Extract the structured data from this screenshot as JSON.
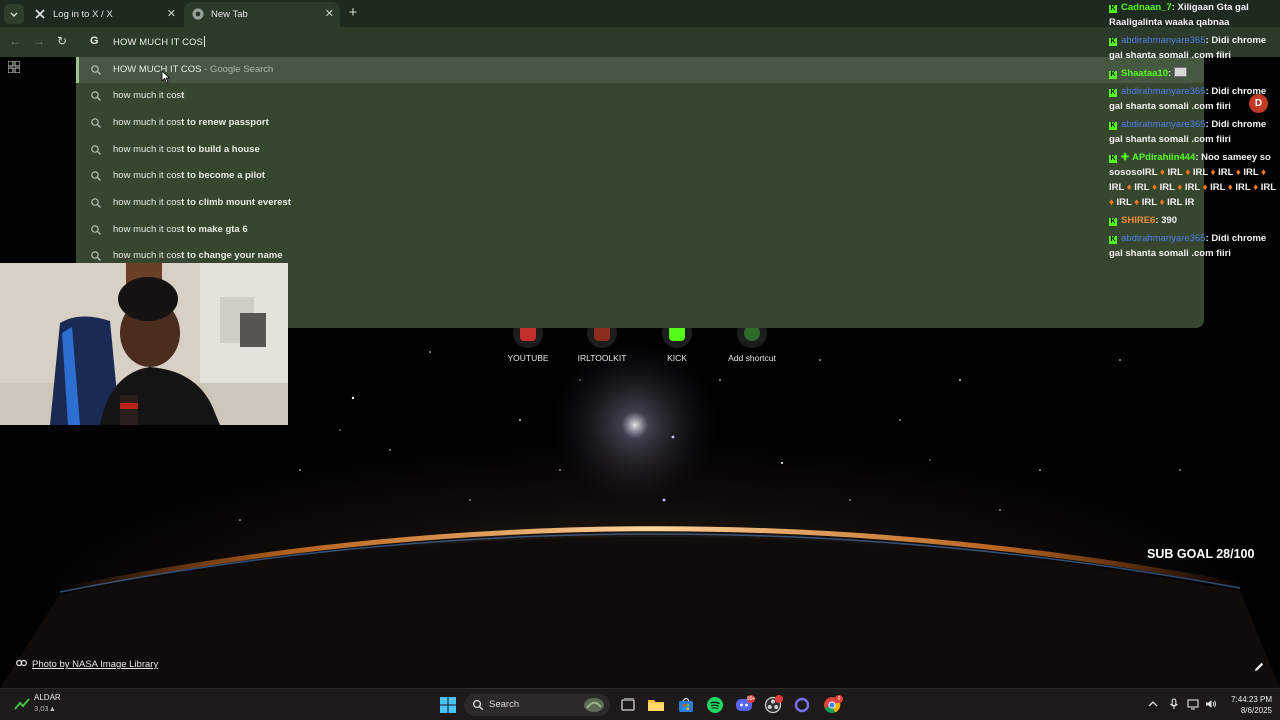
{
  "tabs": [
    {
      "title": "Log in to X / X",
      "icon": "x-logo-icon",
      "active": false
    },
    {
      "title": "New Tab",
      "icon": "chrome-icon",
      "active": true
    }
  ],
  "omnibox": {
    "g_label": "G",
    "query": "HOW MUCH IT COS"
  },
  "suggestions": [
    {
      "prefix": "HOW MUCH IT COS",
      "suffix": "",
      "suffix_plain": " - Google Search",
      "selected": true
    },
    {
      "prefix": "how much it cos",
      "suffix": "t",
      "suffix_plain": "",
      "selected": false
    },
    {
      "prefix": "how much it cos",
      "suffix": "t to renew passport",
      "suffix_plain": "",
      "selected": false
    },
    {
      "prefix": "how much it cos",
      "suffix": "t to build a house",
      "suffix_plain": "",
      "selected": false
    },
    {
      "prefix": "how much it cos",
      "suffix": "t to become a pilot",
      "suffix_plain": "",
      "selected": false
    },
    {
      "prefix": "how much it cos",
      "suffix": "t to climb mount everest",
      "suffix_plain": "",
      "selected": false
    },
    {
      "prefix": "how much it cos",
      "suffix": "t to make gta 6",
      "suffix_plain": "",
      "selected": false
    },
    {
      "prefix": "how much it cos",
      "suffix": "t to change your name",
      "suffix_plain": "",
      "selected": false
    }
  ],
  "shortcuts": [
    {
      "label": "YOUTUBE",
      "color": "#c4302b"
    },
    {
      "label": "IRLTOOLKIT",
      "color": "#8b2f1c"
    },
    {
      "label": "KICK",
      "color": "#53fc18"
    },
    {
      "label": "Add shortcut",
      "color": "#2f6b2a"
    }
  ],
  "chat": [
    {
      "user": "Cadnaan_7",
      "user_color": "green",
      "text": ": Xiligaan Gta gal Raaligalinta waaka qabnaa"
    },
    {
      "user": "abdirahmanyare365",
      "user_color": "blue",
      "text": ": Didi chrome gal shanta somali .com fiiri"
    },
    {
      "user": "Shaataa10",
      "user_color": "green",
      "text": ": "
    },
    {
      "user": "abdirahmanyare365",
      "user_color": "blue",
      "text": ": Didi chrome gal shanta somali .com fiiri"
    },
    {
      "user": "abdirahmanyare365",
      "user_color": "blue",
      "text": ": Didi chrome gal shanta somali .com fiiri"
    },
    {
      "user": "APdirahiin444",
      "user_color": "green",
      "text": ": Noo sameey so sososolRL IRL IRL IRL IRL IRL IRL IRL IRL IRL IRL IRL IRL IRL IRL IR"
    },
    {
      "user": "SHIRE6",
      "user_color": "orange",
      "text": ": 390"
    },
    {
      "user": "abdirahmanyare365",
      "user_color": "blue",
      "text": ": Didi chrome gal shanta somali .com fiiri"
    }
  ],
  "avatar_letter": "D",
  "sub_goal": "SUB GOAL 28/100",
  "photo_credit": "Photo by NASA Image Library",
  "taskbar": {
    "stock_name": "ALDAR",
    "stock_value": "3,03▲",
    "search_label": "Search",
    "discord_badge": "99+",
    "chrome_badge": "0",
    "time": "7:44:23 PM",
    "date": "8/6/2025"
  },
  "colors": {
    "kick_green": "#53fc18",
    "chrome_frame": "#2c3a2a",
    "dropdown": "#37462f"
  }
}
